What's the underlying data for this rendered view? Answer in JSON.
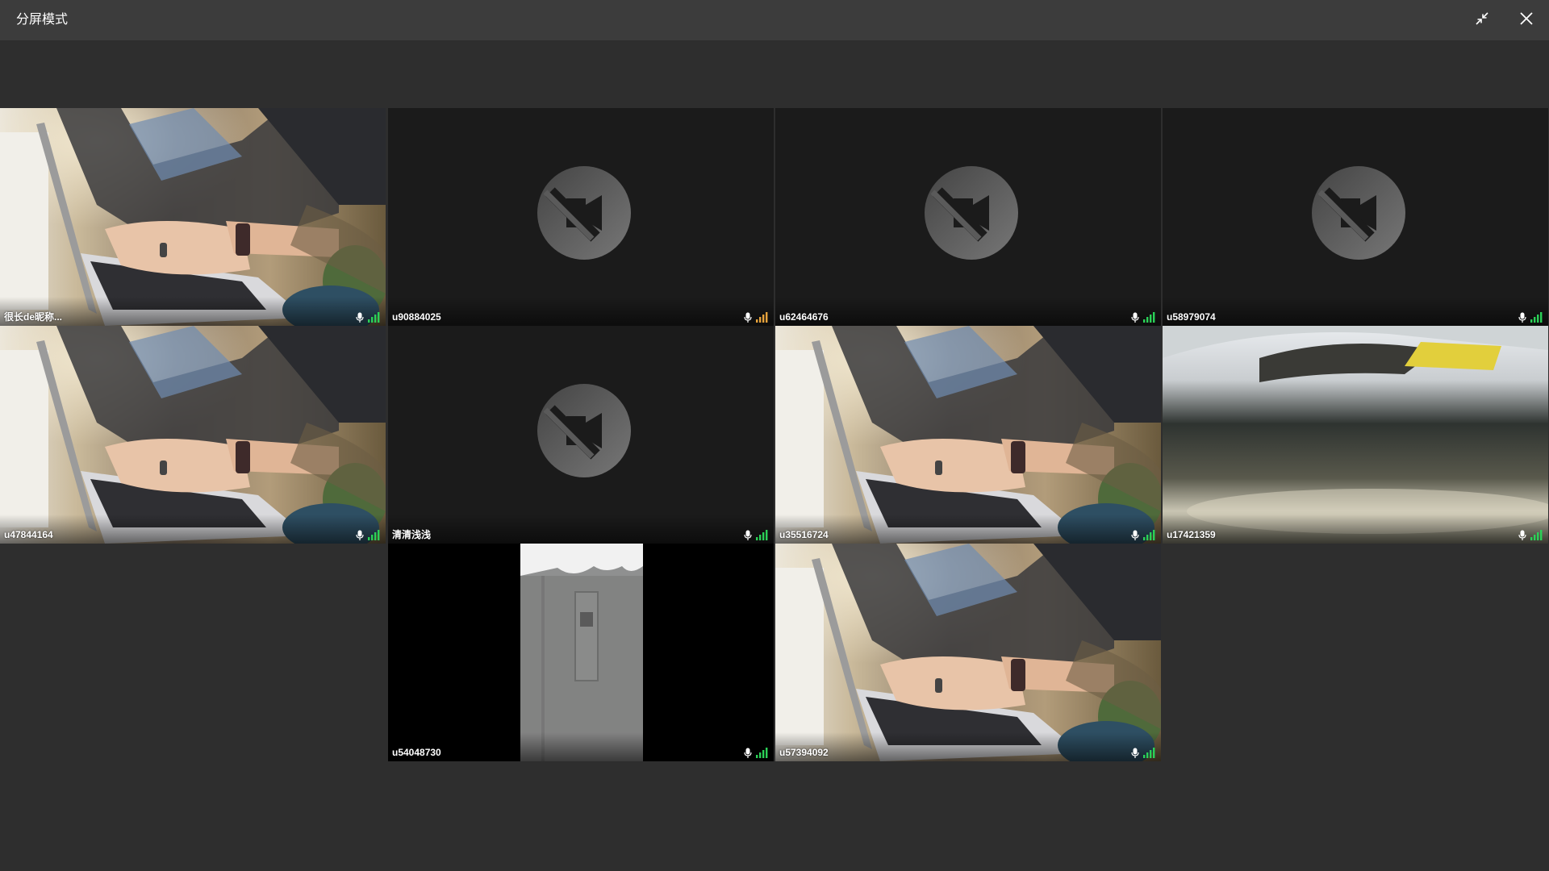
{
  "window": {
    "title": "分屏模式",
    "icons": {
      "collapse": "collapse-arrows-icon",
      "close": "close-icon"
    }
  },
  "tiles": [
    {
      "name": "很长de昵称...",
      "video": "laptop",
      "signal_level": 4,
      "signal_color": "#2bd157"
    },
    {
      "name": "u90884025",
      "video": "camera-off",
      "signal_level": 4,
      "signal_color": "#e6a23c"
    },
    {
      "name": "u62464676",
      "video": "camera-off",
      "signal_level": 4,
      "signal_color": "#2bd157"
    },
    {
      "name": "u58979074",
      "video": "camera-off",
      "signal_level": 4,
      "signal_color": "#2bd157"
    },
    {
      "name": "u47844164",
      "video": "laptop",
      "signal_level": 4,
      "signal_color": "#2bd157"
    },
    {
      "name": "清清浅浅",
      "video": "camera-off",
      "signal_level": 4,
      "signal_color": "#2bd157"
    },
    {
      "name": "u35516724",
      "video": "laptop",
      "signal_level": 4,
      "signal_color": "#2bd157"
    },
    {
      "name": "u17421359",
      "video": "blurry-light",
      "signal_level": 4,
      "signal_color": "#2bd157"
    },
    {
      "name": "u54048730",
      "video": "portrait-door",
      "signal_level": 4,
      "signal_color": "#2bd157"
    },
    {
      "name": "u57394092",
      "video": "laptop",
      "signal_level": 4,
      "signal_color": "#2bd157"
    }
  ],
  "colors": {
    "topbar": "#3c3c3c",
    "background": "#2e2e2e",
    "tile_empty": "#1b1b1b"
  }
}
